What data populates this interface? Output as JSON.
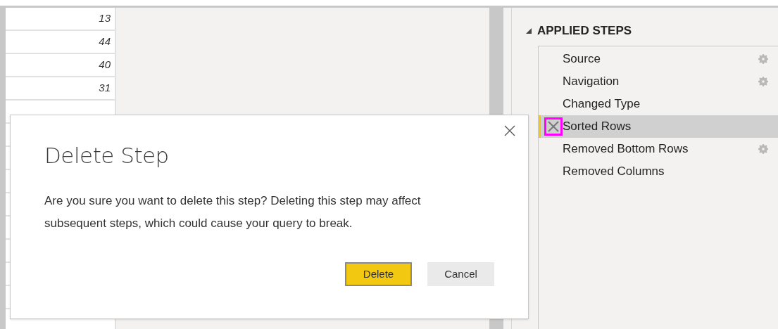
{
  "table": {
    "rows": [
      {
        "value": "13"
      },
      {
        "value": "44"
      },
      {
        "value": "40"
      },
      {
        "value": "31"
      }
    ]
  },
  "applied_steps": {
    "title": "APPLIED STEPS",
    "expanded": true,
    "steps": [
      {
        "name": "Source",
        "has_settings": true,
        "selected": false
      },
      {
        "name": "Navigation",
        "has_settings": true,
        "selected": false
      },
      {
        "name": "Changed Type",
        "has_settings": false,
        "selected": false
      },
      {
        "name": "Sorted Rows",
        "has_settings": false,
        "selected": true
      },
      {
        "name": "Removed Bottom Rows",
        "has_settings": true,
        "selected": false
      },
      {
        "name": "Removed Columns",
        "has_settings": false,
        "selected": false
      }
    ]
  },
  "dialog": {
    "title": "Delete Step",
    "message": "Are you sure you want to delete this step? Deleting this step may affect subsequent steps, which could cause your query to break.",
    "buttons": [
      {
        "label": "Delete",
        "primary": true
      },
      {
        "label": "Cancel",
        "primary": false
      }
    ]
  }
}
